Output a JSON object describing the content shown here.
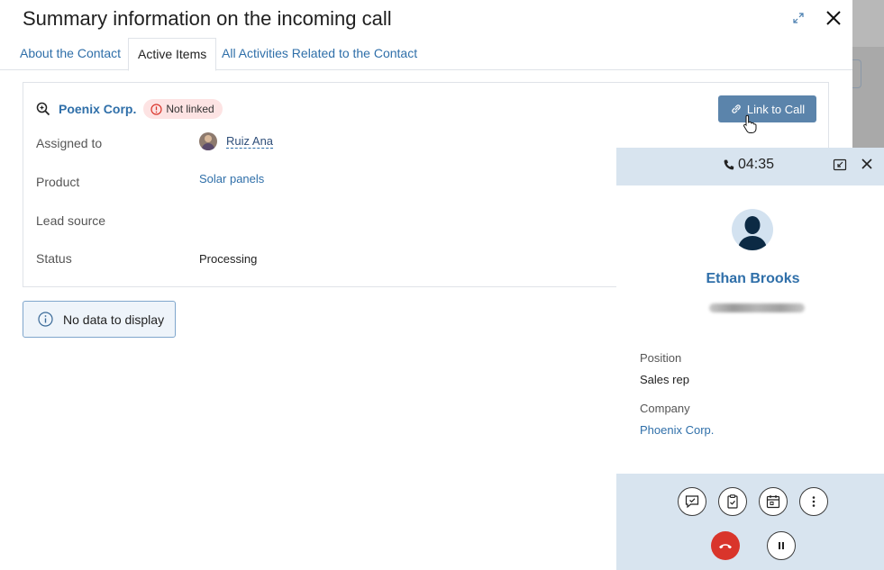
{
  "dialog": {
    "title": "Summary information on the incoming call",
    "tabs": [
      {
        "label": "About the Contact",
        "active": false
      },
      {
        "label": "Active Items",
        "active": true
      },
      {
        "label": "All Activities Related to the Contact",
        "active": false
      }
    ]
  },
  "card": {
    "company": "Poenix Corp.",
    "badge": "Not linked",
    "link_button": "Link to Call",
    "fields": [
      {
        "label": "Assigned to",
        "value": "Ruiz Ana"
      },
      {
        "label": "Product",
        "value": "Solar panels"
      },
      {
        "label": "Lead source",
        "value": ""
      },
      {
        "label": "Status",
        "value": "Processing"
      }
    ]
  },
  "nodata": {
    "text": "No data to display"
  },
  "call": {
    "timer": "04:35",
    "caller_name": "Ethan Brooks",
    "position_label": "Position",
    "position_value": "Sales rep",
    "company_label": "Company",
    "company_value": "Phoenix Corp."
  },
  "icons": {
    "expand": "expand-icon",
    "close": "close-icon",
    "search": "zoom-search-icon",
    "alert": "alert-circle-icon",
    "link": "link-icon",
    "info": "info-icon",
    "phone": "phone-icon",
    "minimize": "minimize-window-icon",
    "comment": "comment-icon",
    "task": "clipboard-check-icon",
    "calendar": "calendar-icon",
    "more": "more-vertical-icon",
    "hangup": "hangup-icon",
    "pause": "pause-icon"
  },
  "colors": {
    "link": "#2f6fa9",
    "button": "#5b84ab",
    "panel": "#d8e4ef",
    "hangup": "#d9352b",
    "badge": "#fde3e3"
  }
}
